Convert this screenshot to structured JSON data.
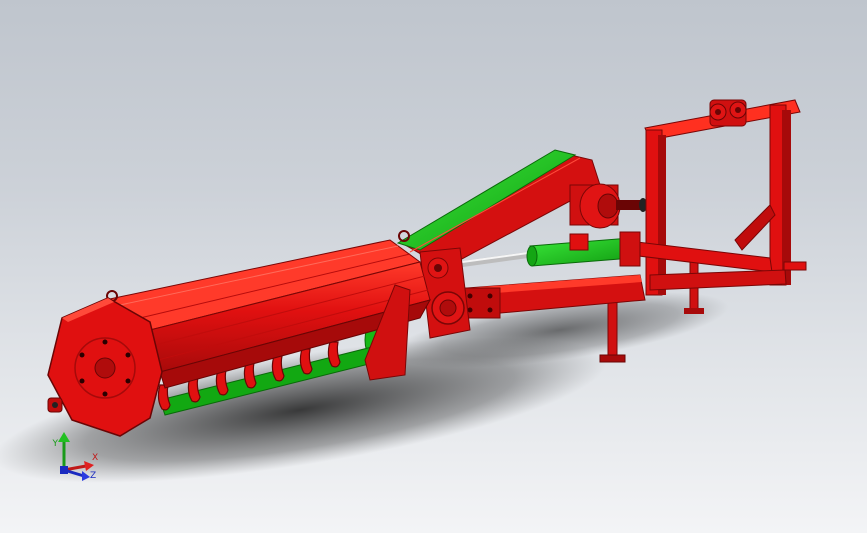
{
  "colors": {
    "red": "#e01010",
    "red_dark": "#a60a0a",
    "red_shadow": "#7a0606",
    "green": "#1fd01f",
    "green_dark": "#0f8f0f",
    "steel": "#e6e6e6"
  },
  "triad": {
    "y_label": "Y",
    "x_label": "X",
    "z_label": "Z"
  }
}
